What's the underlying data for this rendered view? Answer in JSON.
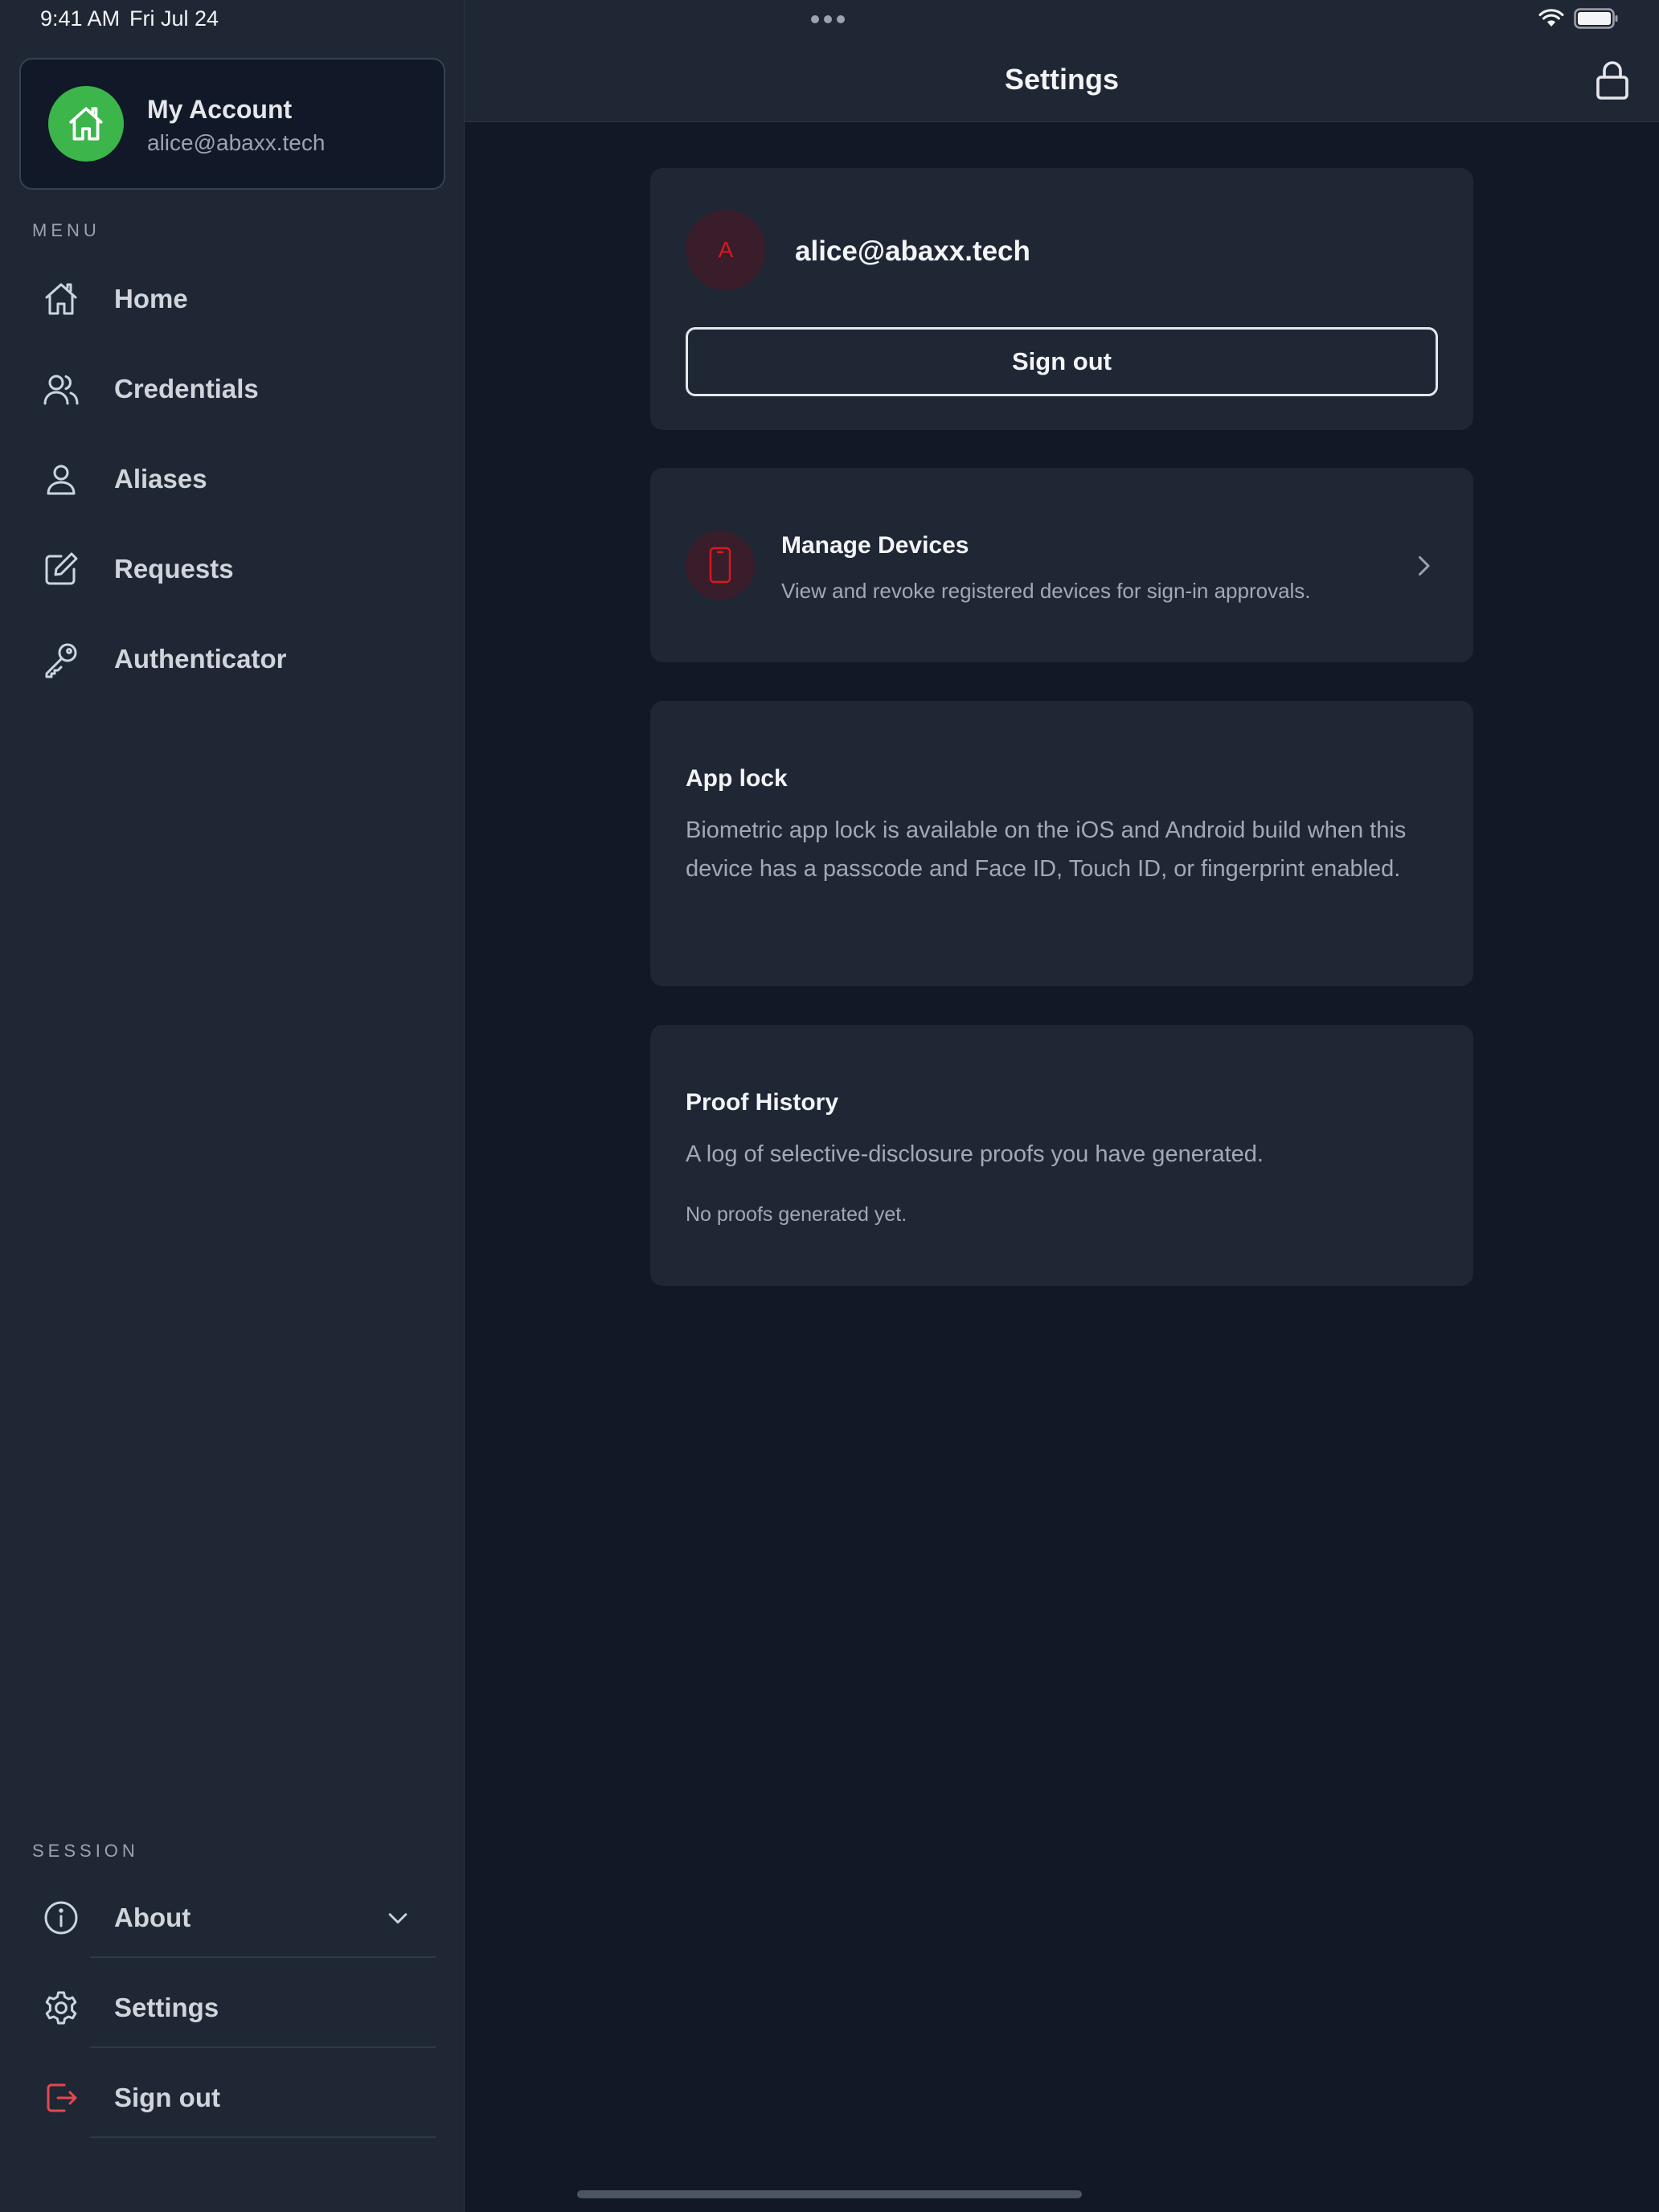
{
  "status_bar": {
    "time": "9:41 AM",
    "date": "Fri Jul 24",
    "icons": [
      "wifi-icon",
      "battery-icon"
    ]
  },
  "sidebar": {
    "account": {
      "name": "My Account",
      "email": "alice@abaxx.tech",
      "avatar_icon": "home-icon",
      "avatar_color": "#3cb54a"
    },
    "menu_label": "MENU",
    "menu_items": [
      {
        "label": "Home",
        "icon": "home-icon"
      },
      {
        "label": "Credentials",
        "icon": "users-icon"
      },
      {
        "label": "Aliases",
        "icon": "user-icon"
      },
      {
        "label": "Requests",
        "icon": "edit-icon"
      },
      {
        "label": "Authenticator",
        "icon": "key-icon"
      }
    ],
    "session_label": "SESSION",
    "session_items": [
      {
        "label": "About",
        "icon": "info-icon"
      },
      {
        "label": "Settings",
        "icon": "gear-icon"
      },
      {
        "label": "Sign out",
        "icon": "sign-out-icon",
        "color": "#e5484d"
      }
    ]
  },
  "header": {
    "title": "Settings",
    "action_icon": "lock-icon"
  },
  "profile_card": {
    "avatar_initial": "A",
    "email": "alice@abaxx.tech",
    "sign_out_label": "Sign out"
  },
  "devices_card": {
    "title": "Manage Devices",
    "description": "View and revoke registered devices for sign-in approvals.",
    "icon": "phone-icon",
    "accent": "#d8191f"
  },
  "app_lock_card": {
    "title": "App lock",
    "description": "Biometric app lock is available on the iOS and Android build when this device has a passcode and Face ID, Touch ID, or fingerprint enabled."
  },
  "proof_history_card": {
    "title": "Proof History",
    "description": "A log of selective-disclosure proofs you have generated.",
    "empty_text": "No proofs generated yet."
  }
}
